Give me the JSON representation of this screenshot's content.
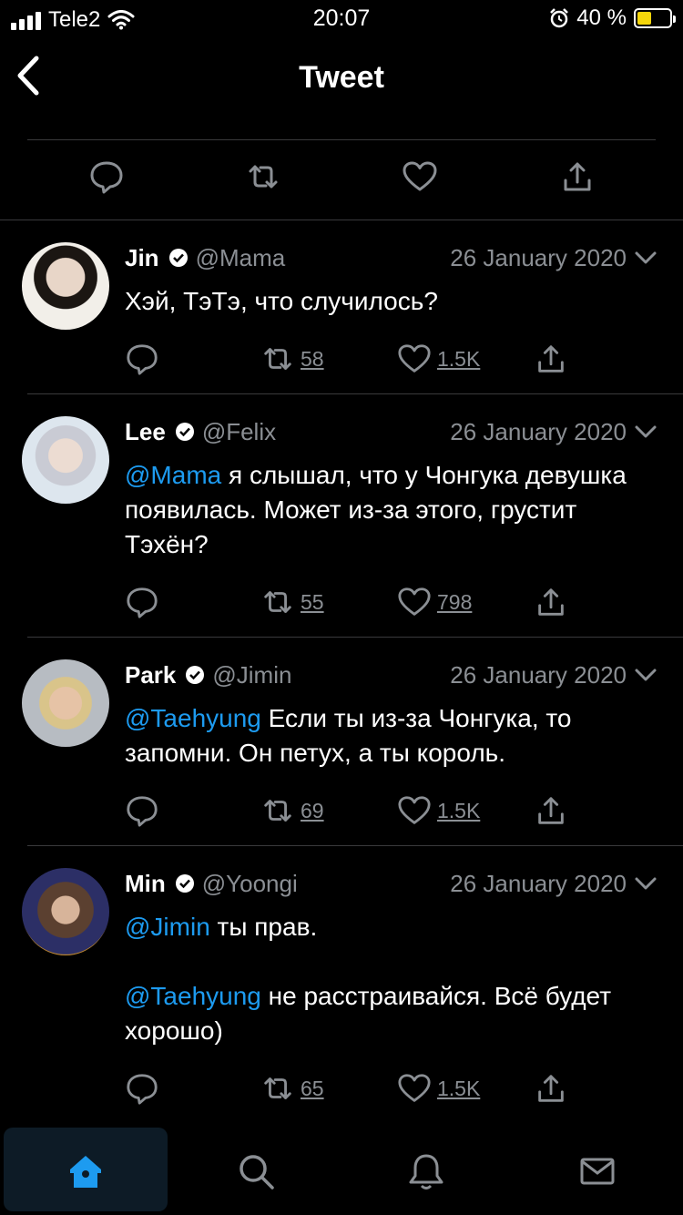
{
  "status": {
    "carrier": "Tele2",
    "time": "20:07",
    "battery": "40 %",
    "battery_level": 0.4,
    "battery_color": "#f5d60b"
  },
  "header": {
    "title": "Tweet"
  },
  "colors": {
    "link": "#1d9bf0",
    "muted": "#8b8f94",
    "background": "#000000"
  },
  "replies": [
    {
      "name": "Jin",
      "handle": "@Mama",
      "date": "26 January 2020",
      "text_parts": [
        {
          "text": "Хэй, ТэТэ, что случилось?",
          "mention": false
        }
      ],
      "retweets": "58",
      "likes": "1.5K"
    },
    {
      "name": "Lee",
      "handle": "@Felix",
      "date": "26 January 2020",
      "text_parts": [
        {
          "text": "@Mama",
          "mention": true
        },
        {
          "text": " я слышал, что у Чонгука девушка появилась. Может из-за этого, грустит Тэхён?",
          "mention": false
        }
      ],
      "retweets": "55",
      "likes": "798"
    },
    {
      "name": "Park",
      "handle": "@Jimin",
      "date": "26 January 2020",
      "text_parts": [
        {
          "text": "@Taehyung",
          "mention": true
        },
        {
          "text": " Если ты из-за Чонгука, то запомни. Он петух, а ты король.",
          "mention": false
        }
      ],
      "retweets": "69",
      "likes": "1.5K"
    },
    {
      "name": "Min",
      "handle": "@Yoongi",
      "date": "26 January 2020",
      "text_parts": [
        {
          "text": "@Jimin",
          "mention": true
        },
        {
          "text": " ты прав.",
          "mention": false
        },
        {
          "text": "\n\n",
          "mention": false
        },
        {
          "text": "@Taehyung",
          "mention": true
        },
        {
          "text": " не расстраивайся. Всё будет хорошо)",
          "mention": false
        }
      ],
      "retweets": "65",
      "likes": "1.5K"
    }
  ],
  "icons": {
    "back": "chevron-left-icon",
    "reply": "speech-bubble-icon",
    "retweet": "retweet-icon",
    "like": "heart-icon",
    "share": "share-icon",
    "home": "home-icon",
    "search": "search-icon",
    "notifications": "bell-icon",
    "messages": "envelope-icon"
  }
}
